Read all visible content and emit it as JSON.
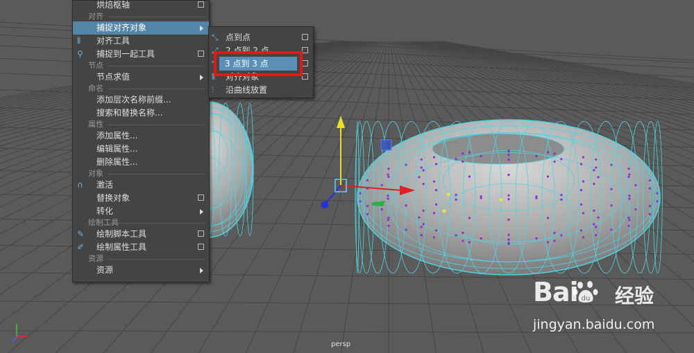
{
  "main_menu": {
    "items": [
      {
        "type": "item",
        "label": "烘焙枢轴",
        "option": true
      },
      {
        "type": "section",
        "label": "对齐"
      },
      {
        "type": "item",
        "label": "捕捉对齐对象",
        "submenu": true,
        "highlighted": true
      },
      {
        "type": "item",
        "label": "对齐工具",
        "icon": "align-icon"
      },
      {
        "type": "item",
        "label": "捕捉到一起工具",
        "option": true,
        "icon": "snap-together-icon"
      },
      {
        "type": "section",
        "label": "节点"
      },
      {
        "type": "item",
        "label": "节点求值",
        "submenu": true
      },
      {
        "type": "section",
        "label": "命名"
      },
      {
        "type": "item",
        "label": "添加层次名称前缀..."
      },
      {
        "type": "item",
        "label": "搜索和替换名称..."
      },
      {
        "type": "section",
        "label": "属性"
      },
      {
        "type": "item",
        "label": "添加属性..."
      },
      {
        "type": "item",
        "label": "编辑属性..."
      },
      {
        "type": "item",
        "label": "删除属性..."
      },
      {
        "type": "section",
        "label": "对象"
      },
      {
        "type": "item",
        "label": "激活",
        "icon": "magnet-icon"
      },
      {
        "type": "item",
        "label": "替换对象",
        "option": true
      },
      {
        "type": "item",
        "label": "转化",
        "submenu": true
      },
      {
        "type": "section",
        "label": "绘制工具"
      },
      {
        "type": "item",
        "label": "绘制脚本工具",
        "option": true,
        "icon": "paint-brush-icon"
      },
      {
        "type": "item",
        "label": "绘制属性工具",
        "option": true,
        "icon": "paint-attribute-icon"
      },
      {
        "type": "section",
        "label": "资源"
      },
      {
        "type": "item",
        "label": "资源",
        "submenu": true
      }
    ]
  },
  "sub_menu": {
    "items": [
      {
        "label": "点到点",
        "option": true,
        "icon": "point-to-point-icon"
      },
      {
        "label": "2 点到 2 点",
        "option": true,
        "icon": "two-points-icon"
      },
      {
        "label": "3 点到 3 点",
        "option": true,
        "icon": "three-points-icon"
      },
      {
        "label": "对齐对象",
        "option": true,
        "icon": "align-objects-icon"
      },
      {
        "label": "沿曲线放置",
        "icon": "place-on-curve-icon"
      }
    ]
  },
  "highlight": {
    "label": "3 点到 3 点",
    "box_color": "#e81717"
  },
  "viewport": {
    "camera_label": "persp",
    "background": "#5a5a5a"
  },
  "watermark": {
    "brand": "Bai",
    "brand_suffix": "经验",
    "url": "jingyan.baidu.com"
  }
}
